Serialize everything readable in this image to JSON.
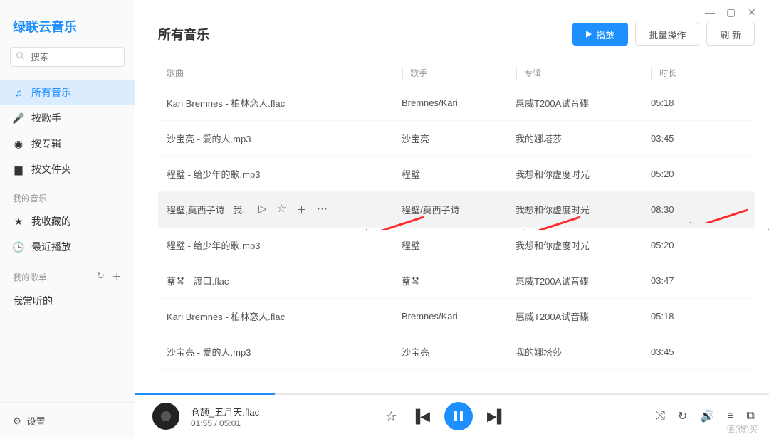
{
  "app_name": "绿联云音乐",
  "search": {
    "placeholder": "搜索"
  },
  "nav": {
    "items": [
      {
        "label": "所有音乐"
      },
      {
        "label": "按歌手"
      },
      {
        "label": "按专辑"
      },
      {
        "label": "按文件夹"
      }
    ],
    "section_my_music": "我的音乐",
    "my_music_items": [
      {
        "label": "我收藏的"
      },
      {
        "label": "最近播放"
      }
    ],
    "section_my_playlist": "我的歌单",
    "playlist_items": [
      {
        "label": "我常听的"
      }
    ]
  },
  "settings_label": "设置",
  "header": {
    "title": "所有音乐",
    "play_btn": "播放",
    "batch_btn": "批量操作",
    "refresh_btn": "刷 新"
  },
  "columns": {
    "song": "歌曲",
    "artist": "歌手",
    "album": "专辑",
    "duration": "时长"
  },
  "tracks": [
    {
      "song": "Kari Bremnes - 柏林恋人.flac",
      "artist": "Bremnes/Kari",
      "album": "惠威T200A试音碟",
      "duration": "05:18"
    },
    {
      "song": "沙宝亮 - 爱的人.mp3",
      "artist": "沙宝亮",
      "album": "我的娜塔莎",
      "duration": "03:45"
    },
    {
      "song": "程璧 - 给少年的歌.mp3",
      "artist": "程璧",
      "album": "我想和你虚度时光",
      "duration": "05:20"
    },
    {
      "song": "程璧,莫西子诗 - 我...",
      "artist": "程璧/莫西子诗",
      "album": "我想和你虚度时光",
      "duration": "08:30",
      "hovered": true
    },
    {
      "song": "程璧 - 给少年的歌.mp3",
      "artist": "程璧",
      "album": "我想和你虚度时光",
      "duration": "05:20"
    },
    {
      "song": "蔡琴 - 渡口.flac",
      "artist": "蔡琴",
      "album": "惠威T200A试音碟",
      "duration": "03:47"
    },
    {
      "song": "Kari Bremnes - 柏林恋人.flac",
      "artist": "Bremnes/Kari",
      "album": "惠威T200A试音碟",
      "duration": "05:18"
    },
    {
      "song": "沙宝亮 - 爱的人.mp3",
      "artist": "沙宝亮",
      "album": "我的娜塔莎",
      "duration": "03:45"
    }
  ],
  "player": {
    "title": "仓颉_五月天.flac",
    "time": "01:55 / 05:01",
    "progress_pct": 22
  },
  "watermark": "值(得)买"
}
